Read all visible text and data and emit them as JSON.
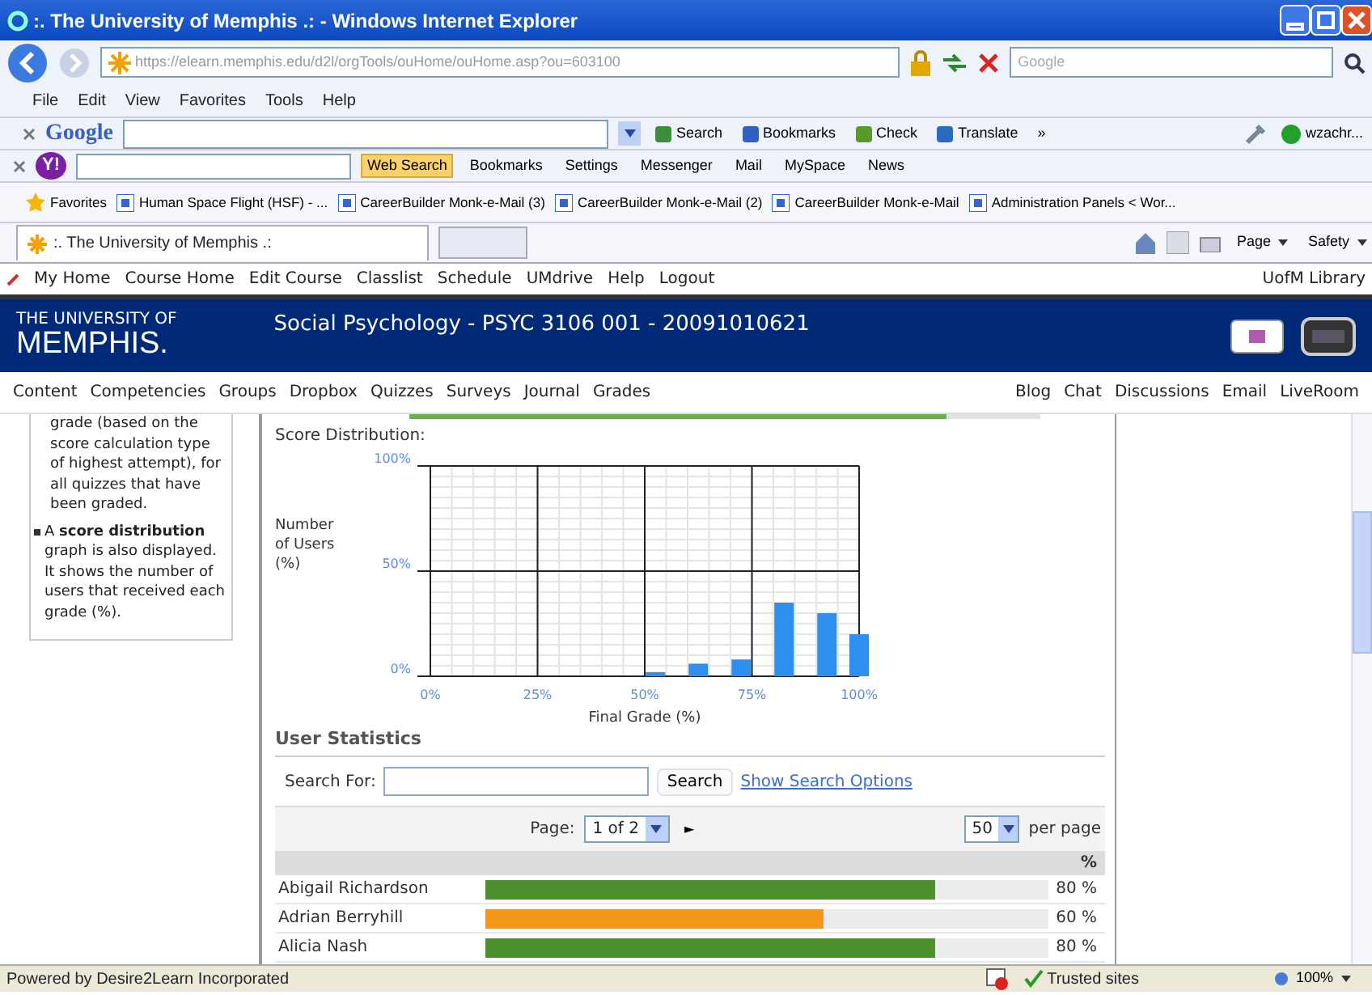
{
  "window": {
    "title": ":. The University of Memphis .: - Windows Internet Explorer"
  },
  "address_bar": {
    "url": "https://elearn.memphis.edu/d2l/orgTools/ouHome/ouHome.asp?ou=603100",
    "search_placeholder": "Google"
  },
  "menu": [
    "File",
    "Edit",
    "View",
    "Favorites",
    "Tools",
    "Help"
  ],
  "google_toolbar": {
    "logo": "Google",
    "items": [
      "Search",
      "Bookmarks",
      "Check",
      "Translate",
      "»"
    ],
    "user": "wzachr..."
  },
  "yahoo_toolbar": {
    "logo": "Y!",
    "items": [
      {
        "label": "Web Search",
        "highlighted": true
      },
      {
        "label": "Bookmarks",
        "highlighted": false
      },
      {
        "label": "Settings",
        "highlighted": false
      },
      {
        "label": "Messenger",
        "highlighted": false
      },
      {
        "label": "Mail",
        "highlighted": false
      },
      {
        "label": "MySpace",
        "highlighted": false
      },
      {
        "label": "News",
        "highlighted": false
      }
    ]
  },
  "favorites_bar": {
    "label": "Favorites",
    "links": [
      "Human Space Flight (HSF) - ...",
      "CareerBuilder Monk-e-Mail (3)",
      "CareerBuilder Monk-e-Mail (2)",
      "CareerBuilder Monk-e-Mail",
      "Administration Panels < Wor..."
    ]
  },
  "tabs": [
    {
      "label": ":. The University of Memphis .:",
      "selected": true
    }
  ],
  "command_bar": [
    "Page",
    "Safety"
  ],
  "top_nav": {
    "links": [
      "My Home",
      "Course Home",
      "Edit Course",
      "Classlist",
      "Schedule",
      "UMdrive",
      "Help",
      "Logout"
    ],
    "right": "UofM Library"
  },
  "banner": {
    "logo_small": "THE UNIVERSITY OF",
    "logo_large": "MEMPHIS.",
    "course_title": "Social Psychology - PSYC 3106 001 - 20091010621"
  },
  "course_nav": {
    "left": [
      "Content",
      "Competencies",
      "Groups",
      "Dropbox",
      "Quizzes",
      "Surveys",
      "Journal",
      "Grades"
    ],
    "right": [
      "Blog",
      "Chat",
      "Discussions",
      "Email",
      "LiveRoom"
    ]
  },
  "help_panel": {
    "paragraph": "grade (based on the score calculation type of highest attempt), for all quizzes that have been graded.",
    "bullets": [
      "A **score distribution** graph is also displayed. It shows the number of users that received each grade (%)."
    ]
  },
  "class_average": {
    "level": 0.85
  },
  "score_distribution": {
    "title": "Score Distribution:",
    "ylabel": "Number of Users (%)",
    "chart_data": {
      "type": "bar",
      "xlabel": "Final Grade (%)",
      "x": [
        52.5,
        62.5,
        72.5,
        82.5,
        92.5,
        100
      ],
      "series": [
        {
          "color": "#2f8ff0",
          "values": [
            2,
            6,
            8,
            35,
            30,
            20
          ]
        }
      ],
      "grid": true,
      "xlim": [
        0,
        100
      ],
      "ylim": [
        0,
        100
      ],
      "xticks": [
        {
          "value": 0,
          "label": "0%"
        },
        {
          "value": 25,
          "label": "25%"
        },
        {
          "value": 50,
          "label": "50%"
        },
        {
          "value": 75,
          "label": "75%"
        },
        {
          "value": 100,
          "label": "100%"
        }
      ],
      "yticks": [
        {
          "value": 0,
          "label": "0%"
        },
        {
          "value": 50,
          "label": "50%"
        },
        {
          "value": 100,
          "label": "100%"
        }
      ]
    }
  },
  "user_statistics": {
    "title": "User Statistics",
    "search_label": "Search For:",
    "search_button": "Search",
    "options_link": "Show Search Options",
    "page_label": "Page:",
    "page_value": "1 of 2",
    "next": "►",
    "per_page_value": "50",
    "per_page_label": "per page",
    "column_header": "%",
    "rows": [
      {
        "name": "Abigail Richardson",
        "level": 0.8,
        "color": "#4e8f2e",
        "percent": "80 %"
      },
      {
        "name": "Adrian Berryhill",
        "level": 0.6,
        "color": "#f5961a",
        "percent": "60 %"
      },
      {
        "name": "Alicia Nash",
        "level": 0.8,
        "color": "#4e8f2e",
        "percent": "80 %"
      }
    ]
  },
  "status_bar": {
    "text": "Powered by Desire2Learn Incorporated",
    "zone": "Trusted sites",
    "zoom": "100%"
  }
}
